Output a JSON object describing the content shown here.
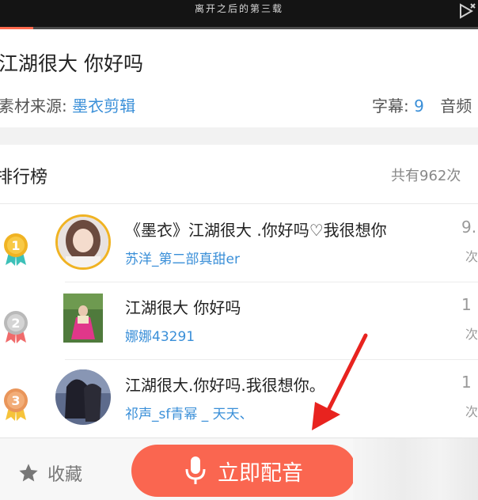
{
  "video": {
    "caption": "离开之后的第三载",
    "progress": 0.07
  },
  "info": {
    "title": "江湖很大 你好吗",
    "source_label": "素材来源:",
    "source_name": "墨衣剪辑",
    "subtitle_label": "字幕:",
    "subtitle_count": "9",
    "audio_label": "音频"
  },
  "ranking": {
    "title": "排行榜",
    "total": "共有962次",
    "rows": [
      {
        "rank": "1",
        "medal_color": "#f0b323",
        "title": "《墨衣》江湖很大 .你好吗♡我很想你",
        "user": "苏洋_第二部真甜er",
        "count": "9.",
        "unit": "次"
      },
      {
        "rank": "2",
        "medal_color": "#b9b9b9",
        "title": "江湖很大 你好吗",
        "user": "娜娜43291",
        "count": "1",
        "unit": "次"
      },
      {
        "rank": "3",
        "medal_color": "#e9955a",
        "title": "江湖很大.你好吗.我很想你。",
        "user": "祁声_sf青幂 _ 天天、",
        "count": "1",
        "unit": "次"
      }
    ]
  },
  "bottom": {
    "favorite_label": "收藏",
    "dub_label": "立即配音"
  },
  "colors": {
    "accent": "#fa6650",
    "link": "#3a8fd8"
  }
}
